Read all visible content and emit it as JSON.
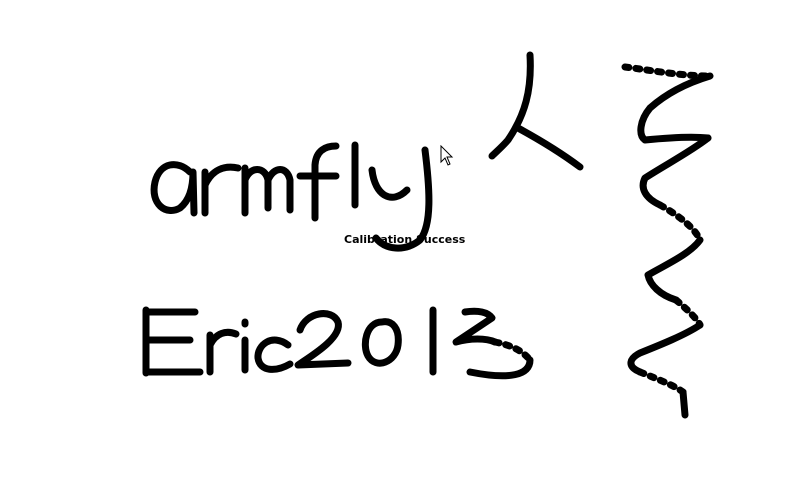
{
  "screen": {
    "background": "#ffffff",
    "ink_color": "#000000"
  },
  "status": {
    "message": "Calibration Success"
  },
  "cursor": {
    "icon": "arrow-pointer-icon"
  },
  "handwriting": [
    "armfly",
    "人",
    "Eric2013"
  ]
}
